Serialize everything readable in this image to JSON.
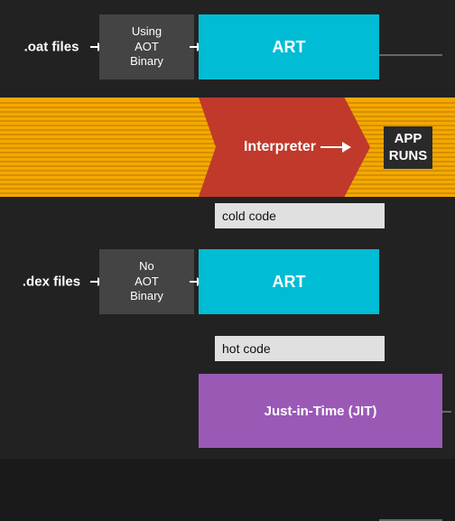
{
  "diagram": {
    "background": "#222",
    "top": {
      "oat_label": ".oat files",
      "using_aot": "Using\nAOT\nBinary",
      "art_label": "ART"
    },
    "middle": {
      "interpreter_label": "Interpreter",
      "app_runs_line1": "APP",
      "app_runs_line2": "RUNS",
      "cold_code": "cold code"
    },
    "bottom": {
      "dex_label": ".dex files",
      "no_aot": "No\nAOT\nBinary",
      "art_label": "ART",
      "hot_code": "hot code"
    },
    "jit": {
      "label": "Just-in-Time (JIT)"
    }
  }
}
